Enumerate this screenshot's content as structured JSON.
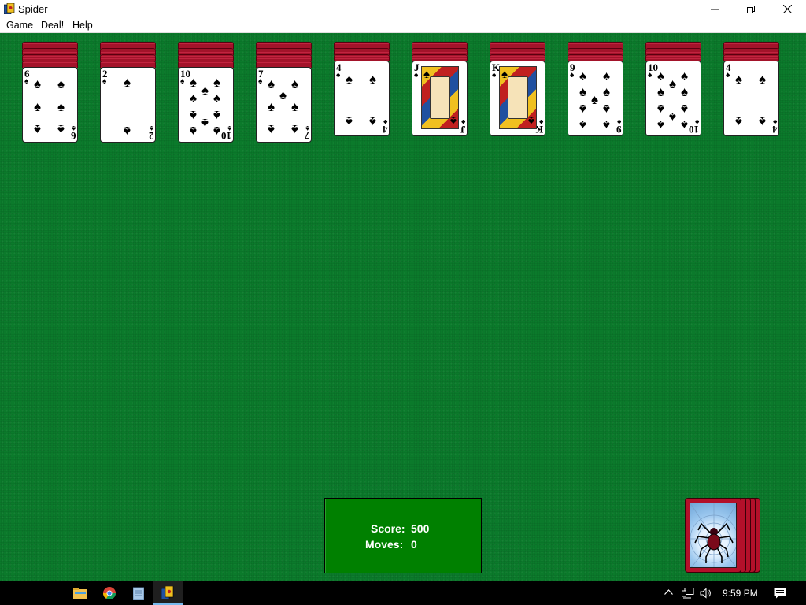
{
  "window": {
    "title": "Spider"
  },
  "menu": {
    "items": [
      "Game",
      "Deal!",
      "Help"
    ]
  },
  "piles": [
    {
      "backs": 4,
      "rank": "6",
      "suit": "♠"
    },
    {
      "backs": 4,
      "rank": "2",
      "suit": "♠"
    },
    {
      "backs": 4,
      "rank": "10",
      "suit": "♠"
    },
    {
      "backs": 4,
      "rank": "7",
      "suit": "♠"
    },
    {
      "backs": 3,
      "rank": "4",
      "suit": "♠"
    },
    {
      "backs": 3,
      "rank": "J",
      "suit": "♠"
    },
    {
      "backs": 3,
      "rank": "K",
      "suit": "♠"
    },
    {
      "backs": 3,
      "rank": "9",
      "suit": "♠"
    },
    {
      "backs": 3,
      "rank": "10",
      "suit": "♠"
    },
    {
      "backs": 3,
      "rank": "4",
      "suit": "♠"
    }
  ],
  "score": {
    "score_label": "Score:",
    "score_value": "500",
    "moves_label": "Moves:",
    "moves_value": "0"
  },
  "stock": {
    "piles_remaining": 5
  },
  "taskbar": {
    "apps": [
      "file-explorer-icon",
      "chrome-icon",
      "notepad-icon",
      "spider-solitaire-icon"
    ],
    "clock": "9:59 PM"
  },
  "colors": {
    "felt": "#0b7a2b",
    "card_back": "#a3132a",
    "score_box": "#008000"
  }
}
